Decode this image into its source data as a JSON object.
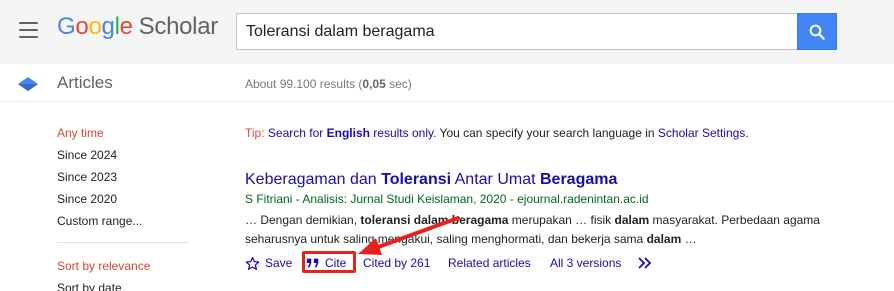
{
  "header": {
    "menu_icon": "hamburger-menu-icon",
    "logo": {
      "google_letters": [
        {
          "ch": "G",
          "color": "#4285f4"
        },
        {
          "ch": "o",
          "color": "#ea4335"
        },
        {
          "ch": "o",
          "color": "#fbbc05"
        },
        {
          "ch": "g",
          "color": "#4285f4"
        },
        {
          "ch": "l",
          "color": "#34a853"
        },
        {
          "ch": "e",
          "color": "#ea4335"
        }
      ],
      "scholar": "Scholar"
    },
    "search": {
      "value": "Toleransi dalam beragama",
      "button_icon": "search-icon",
      "button_color": "#4285f4"
    }
  },
  "subbar": {
    "section_icon": "scholar-cap-icon",
    "section_label": "Articles",
    "results_prefix": "About 99.100 results (",
    "results_time": "0,05",
    "results_suffix": " sec)"
  },
  "sidebar": {
    "time_filters": [
      "Any time",
      "Since 2024",
      "Since 2023",
      "Since 2020",
      "Custom range..."
    ],
    "sort_filters": [
      "Sort by relevance",
      "Sort by date"
    ],
    "active_color": "#d14836"
  },
  "tip": {
    "label": "Tip:",
    "link_pre": "Search for ",
    "link_bold": "English",
    "link_post": " results only",
    "middle": ". You can specify your search language in ",
    "settings_link": "Scholar Settings",
    "end": "."
  },
  "result": {
    "title_parts": [
      {
        "text": "Keberagaman dan ",
        "bold": false
      },
      {
        "text": "Toleransi",
        "bold": true
      },
      {
        "text": " Antar Umat ",
        "bold": false
      },
      {
        "text": "Beragama",
        "bold": true
      }
    ],
    "meta": "S Fitriani - Analisis: Jurnal Studi Keislaman, 2020 - ejournal.radenintan.ac.id",
    "snippet_parts": [
      {
        "text": "… Dengan demikian, ",
        "bold": false
      },
      {
        "text": "toleransi dalam beragama",
        "bold": true
      },
      {
        "text": " merupakan … fisik ",
        "bold": false
      },
      {
        "text": "dalam",
        "bold": true
      },
      {
        "text": " masyarakat. Perbedaan agama seharusnya untuk saling mengakui, saling menghormati, dan bekerja sama ",
        "bold": false
      },
      {
        "text": "dalam",
        "bold": true
      },
      {
        "text": " …",
        "bold": false
      }
    ],
    "actions": {
      "save": "Save",
      "save_icon": "star-outline-icon",
      "cite": "Cite",
      "cite_icon": "quote-icon",
      "cited_by": "Cited by 261",
      "related": "Related articles",
      "versions": "All 3 versions",
      "more_icon": "double-chevron-right-icon"
    }
  },
  "annotation": {
    "highlight_color": "#e8211f",
    "arrow_color": "#e8211f"
  }
}
